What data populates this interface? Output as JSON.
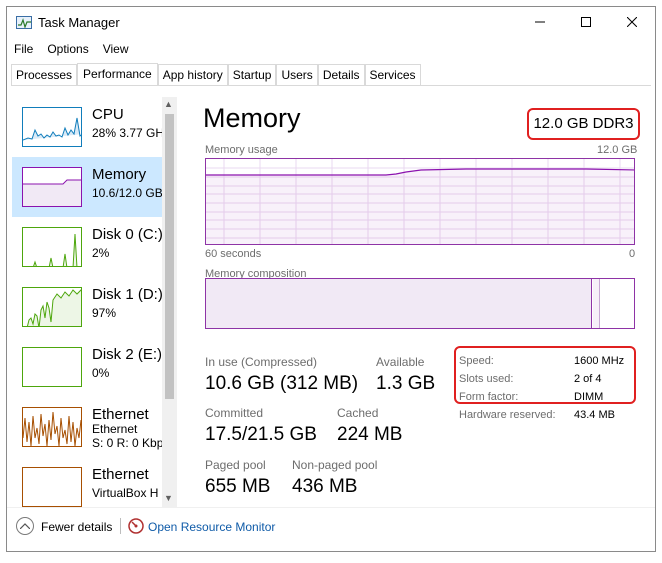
{
  "window": {
    "title": "Task Manager",
    "controls": {
      "minimize": "minimize-icon",
      "maximize": "maximize-icon",
      "close": "close-icon"
    }
  },
  "menu": [
    "File",
    "Options",
    "View"
  ],
  "tabs": [
    {
      "label": "Processes",
      "active": false
    },
    {
      "label": "Performance",
      "active": true
    },
    {
      "label": "App history",
      "active": false
    },
    {
      "label": "Startup",
      "active": false
    },
    {
      "label": "Users",
      "active": false
    },
    {
      "label": "Details",
      "active": false
    },
    {
      "label": "Services",
      "active": false
    }
  ],
  "resources": [
    {
      "name": "CPU",
      "sub": "28%  3.77 GH",
      "color": "#117dbb",
      "selected": false
    },
    {
      "name": "Memory",
      "sub": "10.6/12.0 GB",
      "color": "#8b12ae",
      "selected": true
    },
    {
      "name": "Disk 0 (C:)",
      "sub": "2%",
      "color": "#4da60c",
      "selected": false
    },
    {
      "name": "Disk 1 (D:)",
      "sub": "97%",
      "color": "#4da60c",
      "selected": false
    },
    {
      "name": "Disk 2 (E:)",
      "sub": "0%",
      "color": "#4da60c",
      "selected": false
    },
    {
      "name": "Ethernet",
      "sub": "Ethernet",
      "sub2": "S: 0 R: 0 Kbp",
      "color": "#a74f01",
      "selected": false
    },
    {
      "name": "Ethernet",
      "sub": "VirtualBox H",
      "color": "#a74f01",
      "selected": false
    }
  ],
  "memory": {
    "title": "Memory",
    "spec": "12.0 GB DDR3",
    "usage_label": "Memory usage",
    "usage_max": "12.0 GB",
    "time_span": "60 seconds",
    "time_zero": "0",
    "composition_label": "Memory composition",
    "accent": "#8b12ae",
    "stats": {
      "in_use_label": "In use (Compressed)",
      "in_use_value": "10.6 GB (312 MB)",
      "available_label": "Available",
      "available_value": "1.3 GB",
      "committed_label": "Committed",
      "committed_value": "17.5/21.5 GB",
      "cached_label": "Cached",
      "cached_value": "224 MB",
      "paged_label": "Paged pool",
      "paged_value": "655 MB",
      "nonpaged_label": "Non-paged pool",
      "nonpaged_value": "436 MB"
    },
    "specs": {
      "speed_label": "Speed:",
      "speed_value": "1600 MHz",
      "slots_label": "Slots used:",
      "slots_value": "2 of 4",
      "form_label": "Form factor:",
      "form_value": "DIMM",
      "reserved_label": "Hardware reserved:",
      "reserved_value": "43.4 MB"
    }
  },
  "footer": {
    "fewer_details": "Fewer details",
    "open_monitor": "Open Resource Monitor"
  },
  "highlight_color": "#e02020"
}
